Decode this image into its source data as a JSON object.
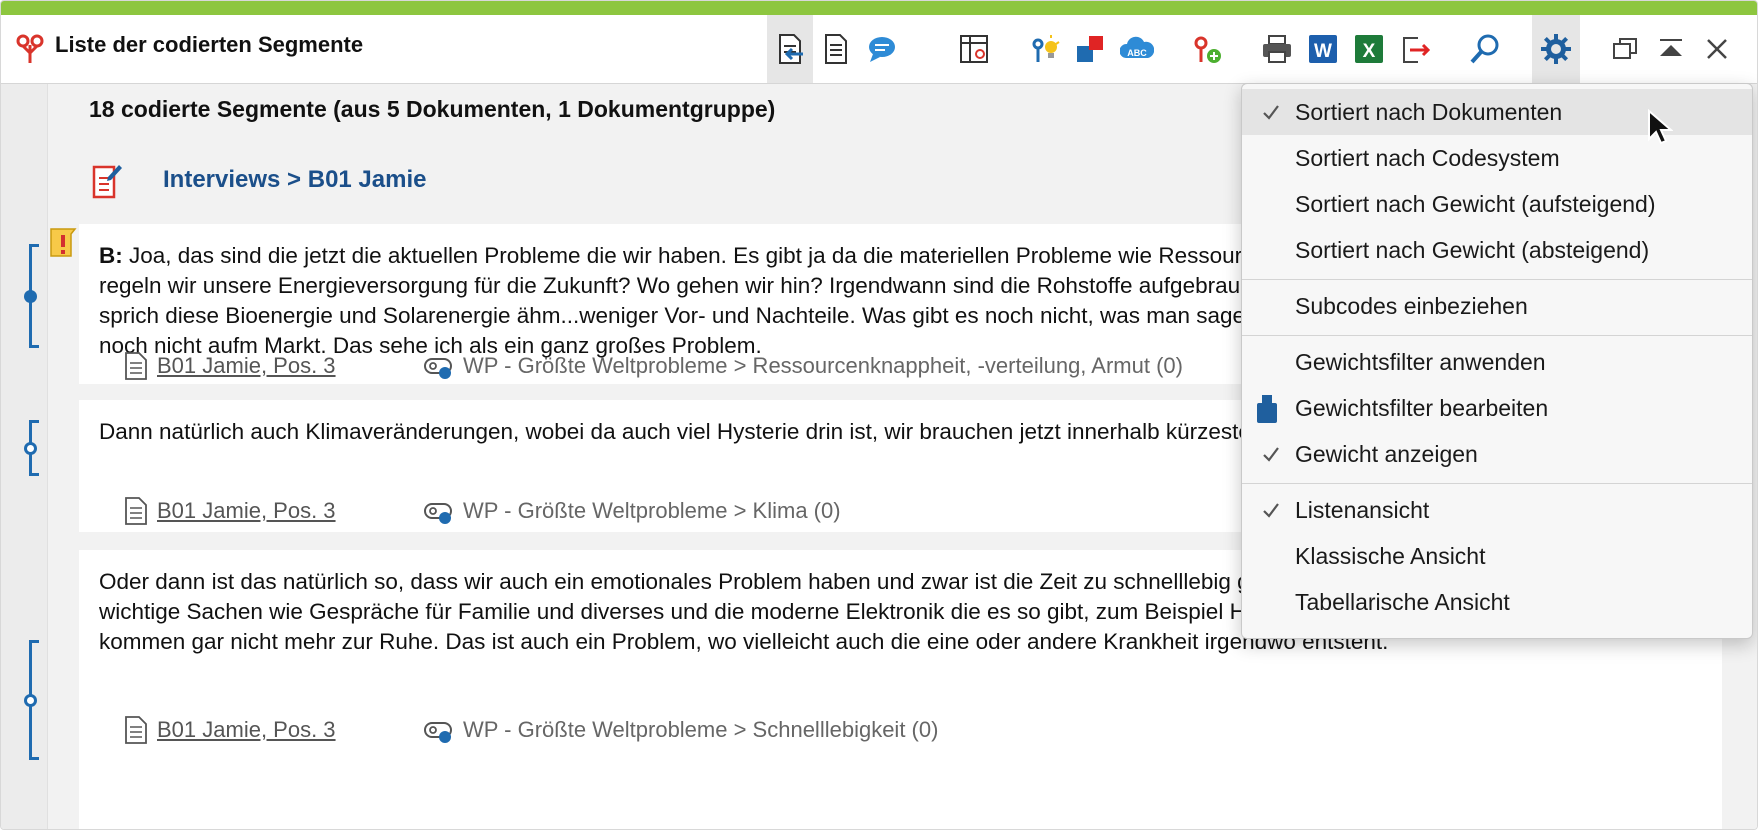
{
  "colors": {
    "accent_bar": "#8dc63f",
    "link_blue": "#1b4f8a",
    "bracket_blue": "#1f6bb0"
  },
  "window": {
    "title": "Liste der codierten Segmente"
  },
  "toolbar": {
    "icons": [
      "document-arrow-icon",
      "document-list-icon",
      "speech-bubble-icon",
      "table-grid-icon",
      "lightbulb-code-icon",
      "color-squares-icon",
      "cloud-abc-icon",
      "code-add-icon",
      "print-icon",
      "word-export-icon",
      "excel-export-icon",
      "export-arrow-icon",
      "search-icon",
      "settings-gear-icon",
      "restore-window-icon",
      "collapse-up-icon",
      "close-icon"
    ]
  },
  "summary": "18 codierte Segmente (aus 5 Dokumenten, 1 Dokumentgruppe)",
  "document_header": {
    "title": "Interviews > B01 Jamie"
  },
  "segments": [
    {
      "speaker": "B:",
      "text": " Joa, das sind die jetzt die aktuellen Probleme die wir haben. Es gibt ja da die materiellen Probleme wie Ressourcenknappheit, weil wir wenig Öl haben, wie regeln wir unsere Energieversorgung für die Zukunft? Wo gehen wir hin? Irgendwann sind die Rohstoffe aufgebraucht, dann ist die Frage welche Alternativen sprich diese Bioenergie und Solarenergie ähm...weniger Vor- und Nachteile. Was gibt es noch nicht, was man sagen könnte dass es ausgereift ist. Das gibt es ja noch nicht aufm Markt. Das sehe ich als ein ganz großes Problem.",
      "doc_ref": "B01 Jamie, Pos. 3",
      "code_ref": "WP - Größte Weltprobleme > Ressourcenknappheit, -verteilung, Armut (0)",
      "has_weight_icon": true
    },
    {
      "speaker": "",
      "text": "Dann natürlich auch Klimaveränderungen, wobei da auch viel Hysterie drin ist, wir brauchen jetzt innerhalb kürzester Zeit das Ruder rumdrehen, was in den letzten 60 Jahren in die Atmosphäre geblasen worden ist, also das sollte man auch nicht vergessen.",
      "doc_ref": "B01 Jamie, Pos. 3",
      "code_ref": "WP - Größte Weltprobleme > Klima (0)",
      "has_weight_icon": false
    },
    {
      "speaker": "",
      "text": "Oder dann ist das natürlich so, dass wir auch ein emotionales Problem haben und zwar ist die Zeit zu schnelllebig geworden. Wir nehmen uns zu wenig Zeit für wichtige Sachen wie Gespräche für Familie und diverses und die moderne Elektronik die es so gibt, zum Beispiel Handys, klingeln rund um die Uhr und wir kommen gar nicht mehr zur Ruhe. Das ist auch ein Problem, wo vielleicht auch die eine oder andere Krankheit irgendwo entsteht.",
      "doc_ref": "B01 Jamie, Pos. 3",
      "code_ref": "WP - Größte Weltprobleme > Schnelllebigkeit (0)",
      "has_weight_icon": false
    }
  ],
  "menu": {
    "items": [
      {
        "label": "Sortiert nach Dokumenten",
        "checked": true,
        "highlighted": true
      },
      {
        "label": "Sortiert nach Codesystem",
        "checked": false
      },
      {
        "label": "Sortiert nach Gewicht (aufsteigend)",
        "checked": false
      },
      {
        "label": "Sortiert nach Gewicht (absteigend)",
        "checked": false
      },
      {
        "label": "Subcodes einbeziehen",
        "checked": false
      },
      {
        "label": "Gewichtsfilter anwenden",
        "checked": false
      },
      {
        "label": "Gewichtsfilter bearbeiten",
        "checked": false,
        "icon": "weight-icon"
      },
      {
        "label": "Gewicht anzeigen",
        "checked": true
      },
      {
        "label": "Listenansicht",
        "checked": true
      },
      {
        "label": "Klassische Ansicht",
        "checked": false
      },
      {
        "label": "Tabellarische Ansicht",
        "checked": false
      }
    ]
  }
}
